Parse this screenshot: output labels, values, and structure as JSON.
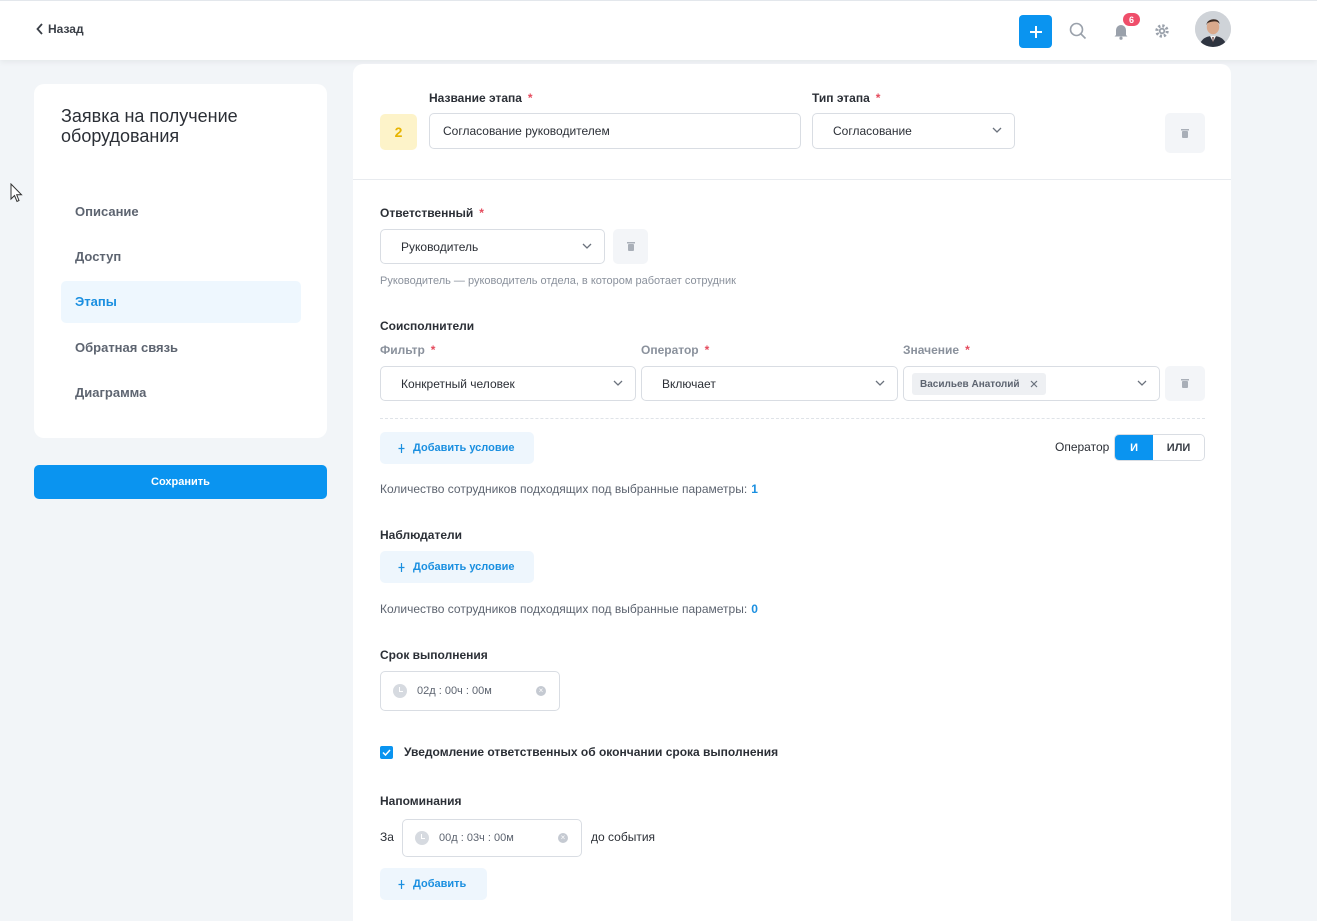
{
  "header": {
    "back_label": "Назад",
    "notifications_count": "6"
  },
  "sidebar": {
    "title": "Заявка на получение оборудования",
    "items": [
      {
        "label": "Описание"
      },
      {
        "label": "Доступ"
      },
      {
        "label": "Этапы"
      },
      {
        "label": "Обратная связь"
      },
      {
        "label": "Диаграмма"
      }
    ],
    "active_item": "Этапы",
    "save_label": "Сохранить"
  },
  "stage": {
    "number": "2",
    "name_label": "Название этапа",
    "name_value": "Согласование руководителем",
    "type_label": "Тип этапа",
    "type_value": "Согласование"
  },
  "responsible": {
    "label": "Ответственный",
    "value": "Руководитель",
    "hint": "Руководитель — руководитель отдела, в котором работает сотрудник"
  },
  "co_executors": {
    "label": "Соисполнители",
    "filter_label": "Фильтр",
    "filter_value": "Конкретный человек",
    "operator_label": "Оператор",
    "operator_value": "Включает",
    "value_label": "Значение",
    "value_tag": "Васильев Анатолий",
    "add_condition_label": "Добавить условие",
    "logic_operator_label": "Оператор",
    "logic_and": "И",
    "logic_or": "ИЛИ",
    "logic_selected": "И",
    "count_text": "Количество сотрудников подходящих под выбранные параметры:",
    "count_value": "1"
  },
  "observers": {
    "label": "Наблюдатели",
    "add_condition_label": "Добавить условие",
    "count_text": "Количество сотрудников подходящих под выбранные параметры:",
    "count_value": "0"
  },
  "deadline": {
    "label": "Срок выполнения",
    "value": "02д : 00ч : 00м"
  },
  "notify": {
    "checked": true,
    "label": "Уведомление ответственных об окончании срока выполнения"
  },
  "reminders": {
    "label": "Напоминания",
    "prefix": "За",
    "value": "00д : 03ч : 00м",
    "suffix": "до события",
    "add_label": "Добавить"
  },
  "colors": {
    "accent": "#0a94f0",
    "badge": "#ef4e6a",
    "required": "#e54b5d",
    "step_badge_bg": "#fdf3c9",
    "step_badge_text": "#e7b400"
  }
}
